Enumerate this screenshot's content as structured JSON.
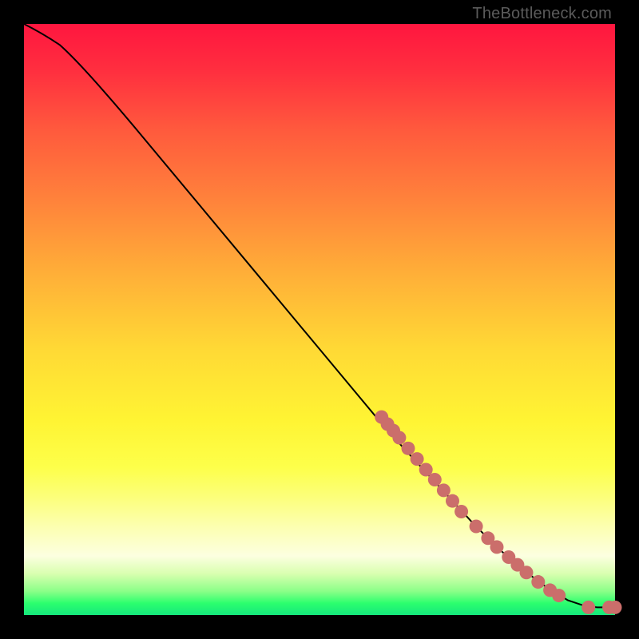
{
  "watermark": "TheBottleneck.com",
  "colors": {
    "dot": "#cb6e6b",
    "line": "#000000",
    "background": "#000000"
  },
  "chart_data": {
    "type": "line",
    "title": "",
    "xlabel": "",
    "ylabel": "",
    "xlim": [
      0,
      100
    ],
    "ylim": [
      0,
      100
    ],
    "grid": false,
    "legend": false,
    "curve": [
      {
        "x": 0,
        "y": 100
      },
      {
        "x": 3,
        "y": 98.5
      },
      {
        "x": 6,
        "y": 96.5
      },
      {
        "x": 10,
        "y": 93
      },
      {
        "x": 20,
        "y": 81
      },
      {
        "x": 30,
        "y": 69
      },
      {
        "x": 40,
        "y": 57
      },
      {
        "x": 50,
        "y": 45
      },
      {
        "x": 60,
        "y": 33
      },
      {
        "x": 64,
        "y": 28.5
      },
      {
        "x": 70,
        "y": 22
      },
      {
        "x": 76,
        "y": 15.5
      },
      {
        "x": 80,
        "y": 11.5
      },
      {
        "x": 84,
        "y": 8
      },
      {
        "x": 88,
        "y": 5
      },
      {
        "x": 92,
        "y": 2.5
      },
      {
        "x": 95,
        "y": 1.5
      },
      {
        "x": 97,
        "y": 1.3
      },
      {
        "x": 100,
        "y": 1.3
      }
    ],
    "points": [
      {
        "x": 60.5,
        "y": 33.5
      },
      {
        "x": 61.5,
        "y": 32.3
      },
      {
        "x": 62.5,
        "y": 31.2
      },
      {
        "x": 63.5,
        "y": 30.0
      },
      {
        "x": 65.0,
        "y": 28.2
      },
      {
        "x": 66.5,
        "y": 26.4
      },
      {
        "x": 68.0,
        "y": 24.6
      },
      {
        "x": 69.5,
        "y": 22.9
      },
      {
        "x": 71.0,
        "y": 21.1
      },
      {
        "x": 72.5,
        "y": 19.3
      },
      {
        "x": 74.0,
        "y": 17.5
      },
      {
        "x": 76.5,
        "y": 15.0
      },
      {
        "x": 78.5,
        "y": 13.0
      },
      {
        "x": 80.0,
        "y": 11.5
      },
      {
        "x": 82.0,
        "y": 9.8
      },
      {
        "x": 83.5,
        "y": 8.5
      },
      {
        "x": 85.0,
        "y": 7.2
      },
      {
        "x": 87.0,
        "y": 5.6
      },
      {
        "x": 89.0,
        "y": 4.2
      },
      {
        "x": 90.5,
        "y": 3.3
      },
      {
        "x": 95.5,
        "y": 1.3
      },
      {
        "x": 99.0,
        "y": 1.3
      },
      {
        "x": 100.0,
        "y": 1.3
      }
    ],
    "point_radius": 8.5
  }
}
